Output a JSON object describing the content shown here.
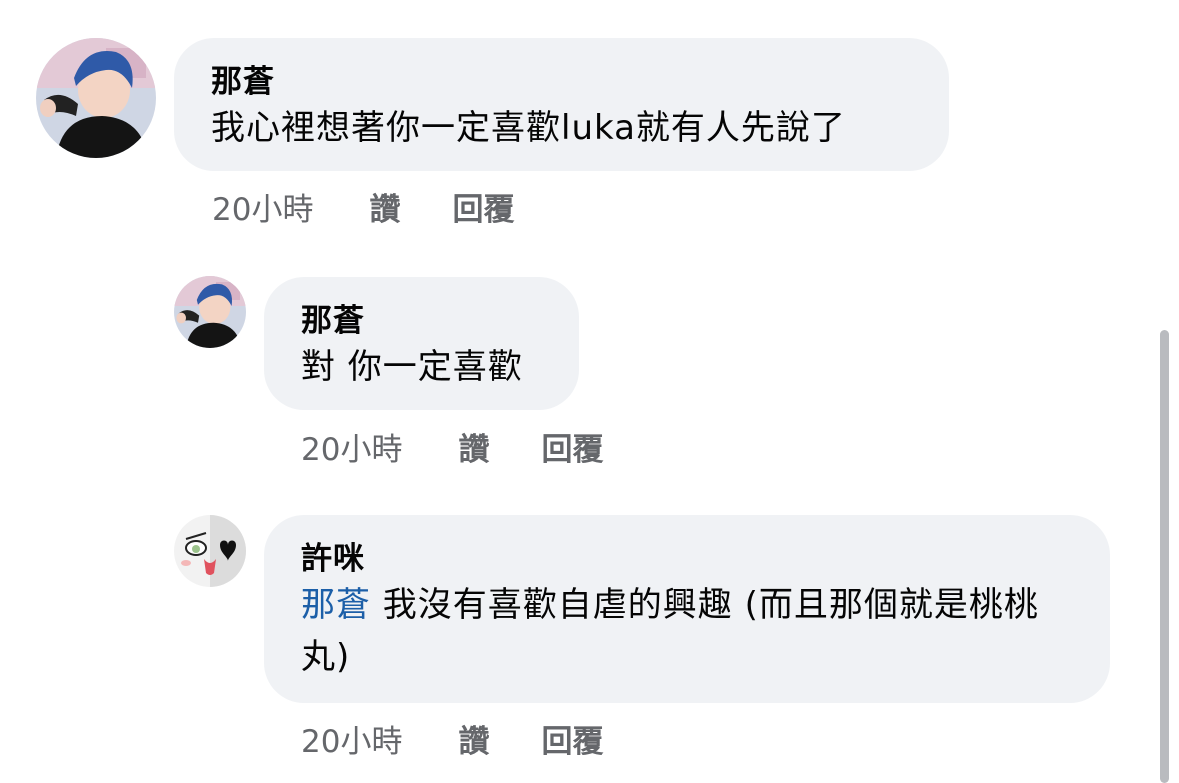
{
  "comments": [
    {
      "author": "那蒼",
      "mention": "",
      "text": "我心裡想著你一定喜歡luka就有人先說了",
      "actions": {
        "time": "20小時",
        "like": "讚",
        "reply": "回覆"
      }
    },
    {
      "author": "那蒼",
      "mention": "",
      "text": "對 你一定喜歡",
      "actions": {
        "time": "20小時",
        "like": "讚",
        "reply": "回覆"
      }
    },
    {
      "author": "許咪",
      "mention": "那蒼",
      "text": " 我沒有喜歡自虐的興趣 (而且那個就是桃桃丸)",
      "actions": {
        "time": "20小時",
        "like": "讚",
        "reply": "回覆"
      }
    }
  ],
  "colors": {
    "bubble": "#f0f2f5",
    "mention": "#1c5fa8",
    "secondary_text": "#65676b"
  },
  "icons": [
    "user-avatar-photo",
    "user-avatar-cartoon"
  ]
}
